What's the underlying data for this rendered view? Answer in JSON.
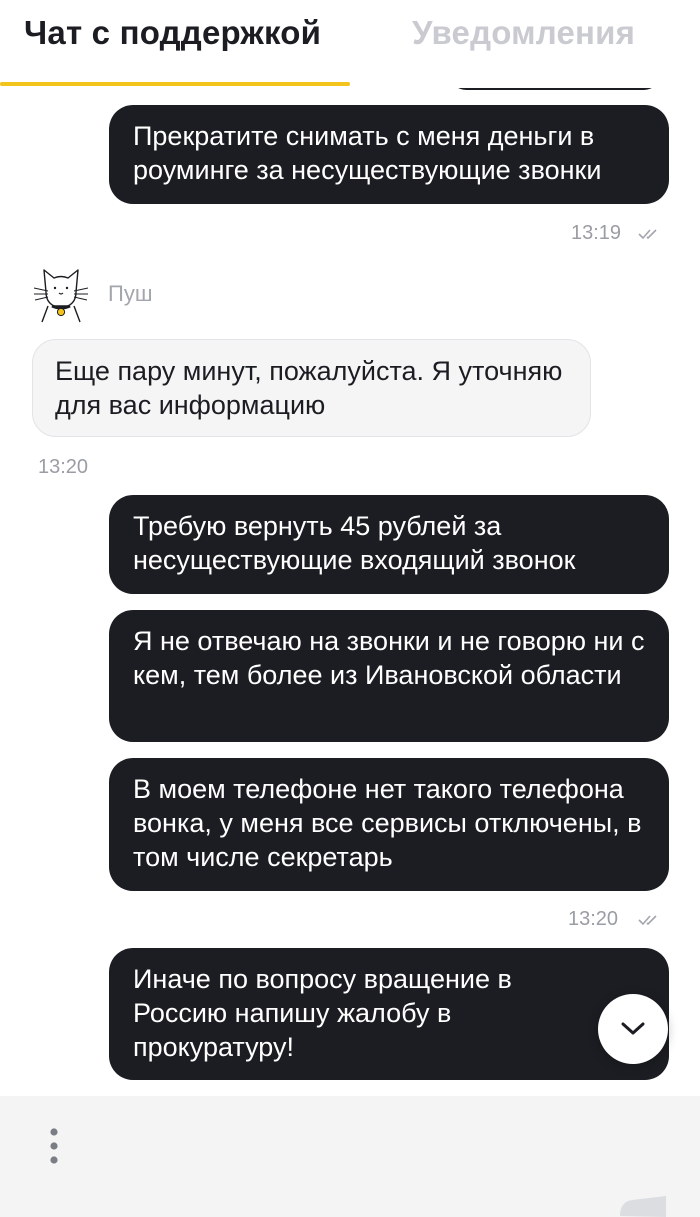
{
  "tabs": {
    "chat_label": "Чат с поддержкой",
    "notifications_label": "Уведомления",
    "accent_color": "#f3c41b"
  },
  "messages": [
    {
      "direction": "out",
      "text": "Прекратите снимать с меня деньги в роуминге за несуществующие звонки"
    },
    {
      "direction": "in",
      "sender": "Пуш",
      "text": "Еще пару минут, пожалуйста. Я уточняю для вас информацию"
    },
    {
      "direction": "out",
      "text": "Требую вернуть 45 рублей за несуществующие входящий звонок"
    },
    {
      "direction": "out",
      "text": "Я не отвечаю на звонки и не говорю ни с кем, тем более из Ивановской области"
    },
    {
      "direction": "out",
      "text": "В моем телефоне нет такого телефона вонка, у меня все сервисы отключены, в том числе секретарь"
    },
    {
      "direction": "out",
      "text": "Иначе по вопросу вращение в Россию напишу жалобу в прокуратуру!"
    }
  ],
  "timestamps": {
    "t1": "13:19",
    "t2": "13:20",
    "t3": "13:20"
  },
  "icons": {
    "avatar": "cat-icon",
    "read": "double-check-icon",
    "scroll": "chevron-down-icon",
    "menu": "vertical-dots-icon",
    "send": "send-icon"
  },
  "colors": {
    "outgoing_bubble": "#1b1d22",
    "incoming_bubble": "#f5f5f6",
    "bottom_bar": "#f4f4f5"
  }
}
